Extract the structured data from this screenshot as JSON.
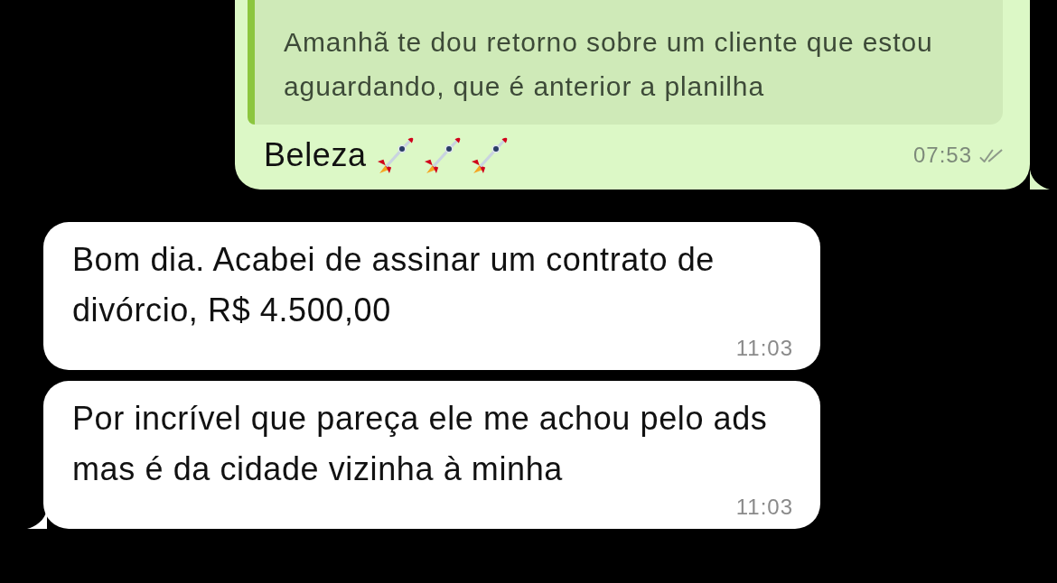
{
  "messages": [
    {
      "kind": "outgoing",
      "quote": "Amanhã te dou retorno sobre um cliente que estou aguardando, que é anterior a planilha",
      "text": "Beleza",
      "time": "07:53",
      "read": false,
      "tail": true
    },
    {
      "kind": "incoming",
      "text": "Bom dia. Acabei de assinar um contrato de divórcio, R$ 4.500,00",
      "time": "11:03",
      "tail": false
    },
    {
      "kind": "incoming",
      "text": "Por incrível que pareça ele me achou pelo ads mas é da cidade vizinha à minha",
      "time": "11:03",
      "tail": true
    }
  ]
}
